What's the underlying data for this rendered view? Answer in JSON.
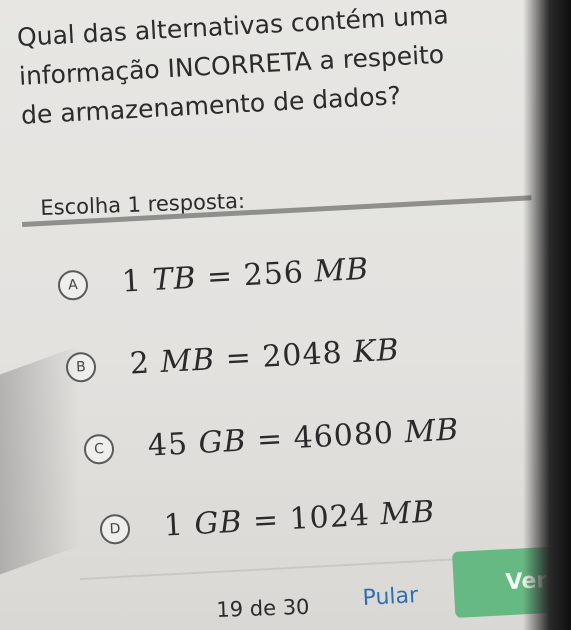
{
  "question": {
    "line1": "Qual das alternativas contém uma",
    "line2": "informação INCORRETA a respeito",
    "line3": "de armazenamento de dados?"
  },
  "instruction": "Escolha 1 resposta:",
  "options": [
    {
      "letter": "A",
      "left": "1",
      "lunit": "TB",
      "right": "256",
      "runit": "MB"
    },
    {
      "letter": "B",
      "left": "2",
      "lunit": "MB",
      "right": "2048",
      "runit": "KB"
    },
    {
      "letter": "C",
      "left": "45",
      "lunit": "GB",
      "right": "46080",
      "runit": "MB"
    },
    {
      "letter": "D",
      "left": "1",
      "lunit": "GB",
      "right": "1024",
      "runit": "MB"
    }
  ],
  "footer": {
    "progress": "19 de 30",
    "skip_label": "Pular",
    "verify_label": "Verifi"
  },
  "colors": {
    "background": "#e5e4e1",
    "accent_link": "#2e6fb0",
    "verify_button": "#67b983"
  }
}
